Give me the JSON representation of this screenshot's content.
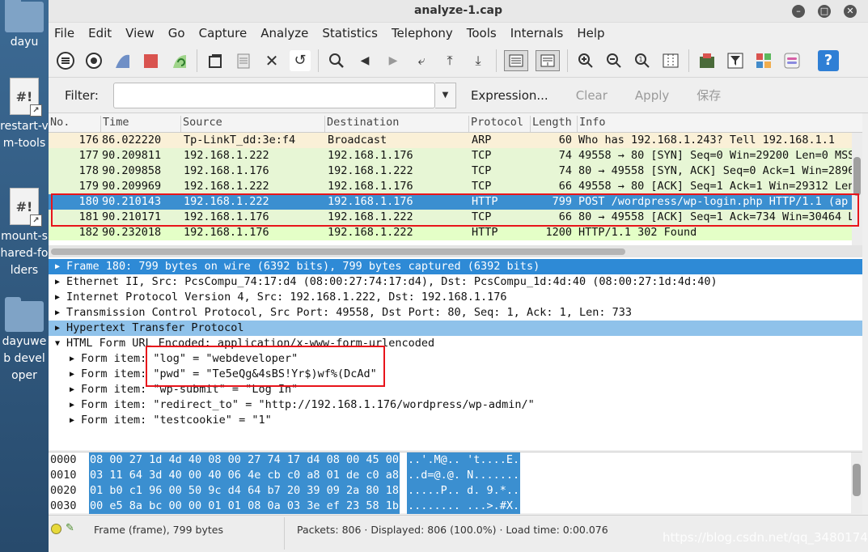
{
  "desktop": {
    "icons": [
      {
        "label": "dayu"
      },
      {
        "label": "restart-vm-tools"
      },
      {
        "label": "mount-shared-folders"
      },
      {
        "label": "dayuweb developer"
      }
    ]
  },
  "window": {
    "title": "analyze-1.cap"
  },
  "menu": [
    "File",
    "Edit",
    "View",
    "Go",
    "Capture",
    "Analyze",
    "Statistics",
    "Telephony",
    "Tools",
    "Internals",
    "Help"
  ],
  "filter": {
    "label": "Filter:",
    "value": "",
    "expression": "Expression...",
    "clear": "Clear",
    "apply": "Apply",
    "save": "保存"
  },
  "packet_list": {
    "columns": [
      "No.",
      "Time",
      "Source",
      "Destination",
      "Protocol",
      "Length",
      "Info"
    ],
    "rows": [
      {
        "no": "176",
        "time": "86.022220",
        "src": "Tp-LinkT_dd:3e:f4",
        "dst": "Broadcast",
        "proto": "ARP",
        "len": "60",
        "info": "Who has 192.168.1.243? Tell 192.168.1.1"
      },
      {
        "no": "177",
        "time": "90.209811",
        "src": "192.168.1.222",
        "dst": "192.168.1.176",
        "proto": "TCP",
        "len": "74",
        "info": "49558 → 80 [SYN] Seq=0 Win=29200 Len=0 MSS="
      },
      {
        "no": "178",
        "time": "90.209858",
        "src": "192.168.1.176",
        "dst": "192.168.1.222",
        "proto": "TCP",
        "len": "74",
        "info": "80 → 49558 [SYN, ACK] Seq=0 Ack=1 Win=28960"
      },
      {
        "no": "179",
        "time": "90.209969",
        "src": "192.168.1.222",
        "dst": "192.168.1.176",
        "proto": "TCP",
        "len": "66",
        "info": "49558 → 80 [ACK] Seq=1 Ack=1 Win=29312 Len="
      },
      {
        "no": "180",
        "time": "90.210143",
        "src": "192.168.1.222",
        "dst": "192.168.1.176",
        "proto": "HTTP",
        "len": "799",
        "info": "POST /wordpress/wp-login.php HTTP/1.1  (ap"
      },
      {
        "no": "181",
        "time": "90.210171",
        "src": "192.168.1.176",
        "dst": "192.168.1.222",
        "proto": "TCP",
        "len": "66",
        "info": "80 → 49558 [ACK] Seq=1 Ack=734 Win=30464 Le"
      },
      {
        "no": "182",
        "time": "90.232018",
        "src": "192.168.1.176",
        "dst": "192.168.1.222",
        "proto": "HTTP",
        "len": "1200",
        "info": "HTTP/1.1 302 Found"
      }
    ]
  },
  "details": [
    {
      "text": "Frame 180: 799 bytes on wire (6392 bits), 799 bytes captured (6392 bits)"
    },
    {
      "text": "Ethernet II, Src: PcsCompu_74:17:d4 (08:00:27:74:17:d4), Dst: PcsCompu_1d:4d:40 (08:00:27:1d:4d:40)"
    },
    {
      "text": "Internet Protocol Version 4, Src: 192.168.1.222, Dst: 192.168.1.176"
    },
    {
      "text": "Transmission Control Protocol, Src Port: 49558, Dst Port: 80, Seq: 1, Ack: 1, Len: 733"
    },
    {
      "text": "Hypertext Transfer Protocol"
    },
    {
      "text": "HTML Form URL Encoded: application/x-www-form-urlencoded"
    },
    {
      "text": "Form item: \"log\" = \"webdeveloper\""
    },
    {
      "text": "Form item: \"pwd\" = \"Te5eQg&4sBS!Yr$)wf%(DcAd\""
    },
    {
      "text": "Form item: \"wp-submit\" = \"Log In\""
    },
    {
      "text": "Form item: \"redirect_to\" = \"http://192.168.1.176/wordpress/wp-admin/\""
    },
    {
      "text": "Form item: \"testcookie\" = \"1\""
    }
  ],
  "hex": [
    {
      "off": "0000",
      "bytes": "08 00 27 1d 4d 40 08 00  27 74 17 d4 08 00 45 00",
      "ascii": "..'.M@.. 't....E."
    },
    {
      "off": "0010",
      "bytes": "03 11 64 3d 40 00 40 06  4e cb c0 a8 01 de c0 a8",
      "ascii": "..d=@.@. N......."
    },
    {
      "off": "0020",
      "bytes": "01 b0 c1 96 00 50 9c d4  64 b7 20 39 09 2a 80 18",
      "ascii": ".....P.. d. 9.*.."
    },
    {
      "off": "0030",
      "bytes": "00 e5 8a bc 00 00 01 01  08 0a 03 3e ef 23 58 1b",
      "ascii": "........ ...>.#X."
    }
  ],
  "status": {
    "left": "Frame (frame), 799 bytes",
    "mid": "Packets: 806 · Displayed: 806 (100.0%) · Load time: 0:00.076",
    "watermark": "https://blog.csdn.net/qq_34801745"
  },
  "colors": {
    "selected": "#3b8fd0",
    "arp": "#faf0d7",
    "tcp": "#e7f6d5",
    "http": "#e4ffc7",
    "highlight": "#e8141b"
  }
}
